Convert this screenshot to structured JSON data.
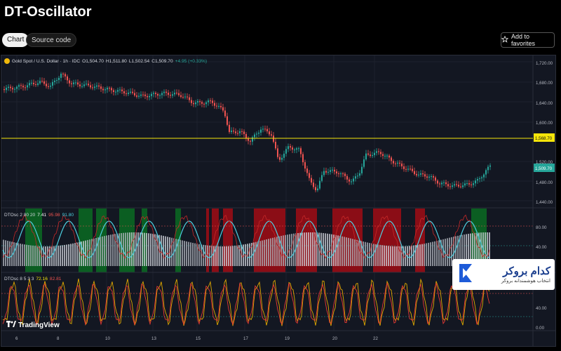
{
  "page": {
    "title": "DT-Oscillator"
  },
  "tabs": [
    {
      "label": "Chart"
    },
    {
      "label": "Source code"
    }
  ],
  "actions": {
    "favorites_label": "Add to favorites"
  },
  "header": {
    "symbol": "Gold Spot / U.S. Dollar · 1h · IDC",
    "open": "O1,504.70",
    "high": "H1,511.80",
    "low": "L1,502.54",
    "close": "C1,509.70",
    "change": "+4.95 (+0.33%)"
  },
  "osc1": {
    "label": "DTOsc 2 80 20",
    "v1": "7.41",
    "v2": "95.98",
    "v3": "91.80"
  },
  "osc2": {
    "label": "DTOsc 8 5 3 3",
    "v1": "72.16",
    "v2": "82.81"
  },
  "price_axis": [
    "1,720.00",
    "1,680.00",
    "1,640.00",
    "1,600.00",
    "1,520.00",
    "1,480.00",
    "1,440.00"
  ],
  "price_badges": {
    "level": "1,568.70",
    "last": "1,509.70"
  },
  "osc_axis": {
    "osc1": [
      "80.00",
      "40.00"
    ],
    "osc2": [
      "40.00",
      "0.00"
    ]
  },
  "time_axis": [
    "6",
    "8",
    "10",
    "13",
    "15",
    "17",
    "19",
    "20",
    "22"
  ],
  "watermark": {
    "title": "کدام بروکر",
    "subtitle": "انتخاب هوشمندانه بروکر"
  },
  "logo": {
    "text": "TradingView"
  },
  "colors": {
    "bull": "#26a69a",
    "bear": "#ef5350",
    "level": "#f5e50a",
    "osc_line": "#4dd0e1",
    "bg": "#131722"
  }
}
